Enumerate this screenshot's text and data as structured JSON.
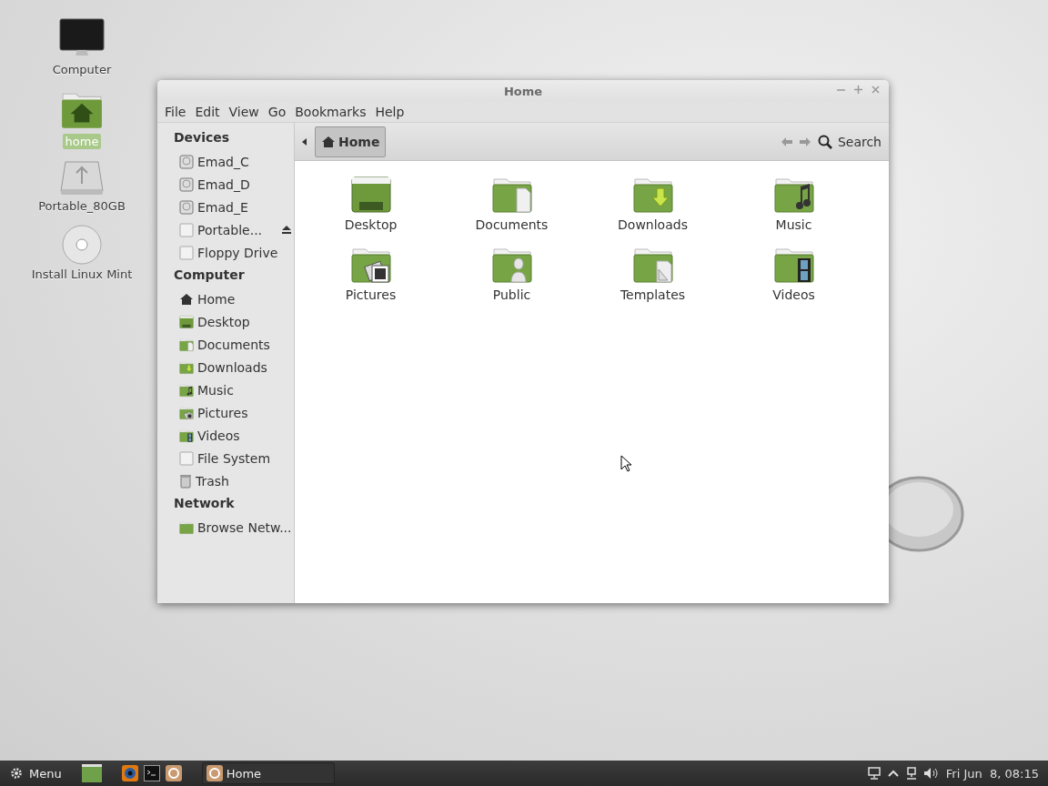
{
  "desktop_icons": [
    {
      "label": "Computer",
      "kind": "computer",
      "selected": false
    },
    {
      "label": "home",
      "kind": "home",
      "selected": true
    },
    {
      "label": "Portable_80GB",
      "kind": "usb",
      "selected": false
    },
    {
      "label": "Install Linux Mint",
      "kind": "disc",
      "selected": false
    }
  ],
  "window": {
    "title": "Home",
    "menu": [
      "File",
      "Edit",
      "View",
      "Go",
      "Bookmarks",
      "Help"
    ],
    "sidebar": [
      {
        "title": "Devices",
        "items": [
          {
            "label": "Emad_C",
            "kind": "disk"
          },
          {
            "label": "Emad_D",
            "kind": "disk"
          },
          {
            "label": "Emad_E",
            "kind": "disk"
          },
          {
            "label": "Portable...",
            "kind": "removable",
            "eject": true
          },
          {
            "label": "Floppy Drive",
            "kind": "removable"
          }
        ]
      },
      {
        "title": "Computer",
        "items": [
          {
            "label": "Home",
            "kind": "home"
          },
          {
            "label": "Desktop",
            "kind": "desktop"
          },
          {
            "label": "Documents",
            "kind": "documents"
          },
          {
            "label": "Downloads",
            "kind": "downloads"
          },
          {
            "label": "Music",
            "kind": "music"
          },
          {
            "label": "Pictures",
            "kind": "pictures"
          },
          {
            "label": "Videos",
            "kind": "videos"
          },
          {
            "label": "File System",
            "kind": "filesystem"
          },
          {
            "label": "Trash",
            "kind": "trash"
          }
        ]
      },
      {
        "title": "Network",
        "items": [
          {
            "label": "Browse Netw...",
            "kind": "network"
          }
        ]
      }
    ],
    "path": [
      {
        "label": "Home",
        "selected": true
      }
    ],
    "search": "Search",
    "files": [
      {
        "label": "Desktop",
        "kind": "desktop"
      },
      {
        "label": "Documents",
        "kind": "documents"
      },
      {
        "label": "Downloads",
        "kind": "downloads"
      },
      {
        "label": "Music",
        "kind": "music"
      },
      {
        "label": "Pictures",
        "kind": "pictures"
      },
      {
        "label": "Public",
        "kind": "public"
      },
      {
        "label": "Templates",
        "kind": "templates"
      },
      {
        "label": "Videos",
        "kind": "videos"
      }
    ]
  },
  "taskbar": {
    "menu": "Menu",
    "launchers": [
      {
        "kind": "show-desktop"
      },
      {
        "kind": "browser"
      },
      {
        "kind": "terminal"
      },
      {
        "kind": "files"
      }
    ],
    "windows": [
      {
        "label": "Home",
        "selected": false
      }
    ],
    "clock": "Fri Jun  8, 08:15"
  }
}
